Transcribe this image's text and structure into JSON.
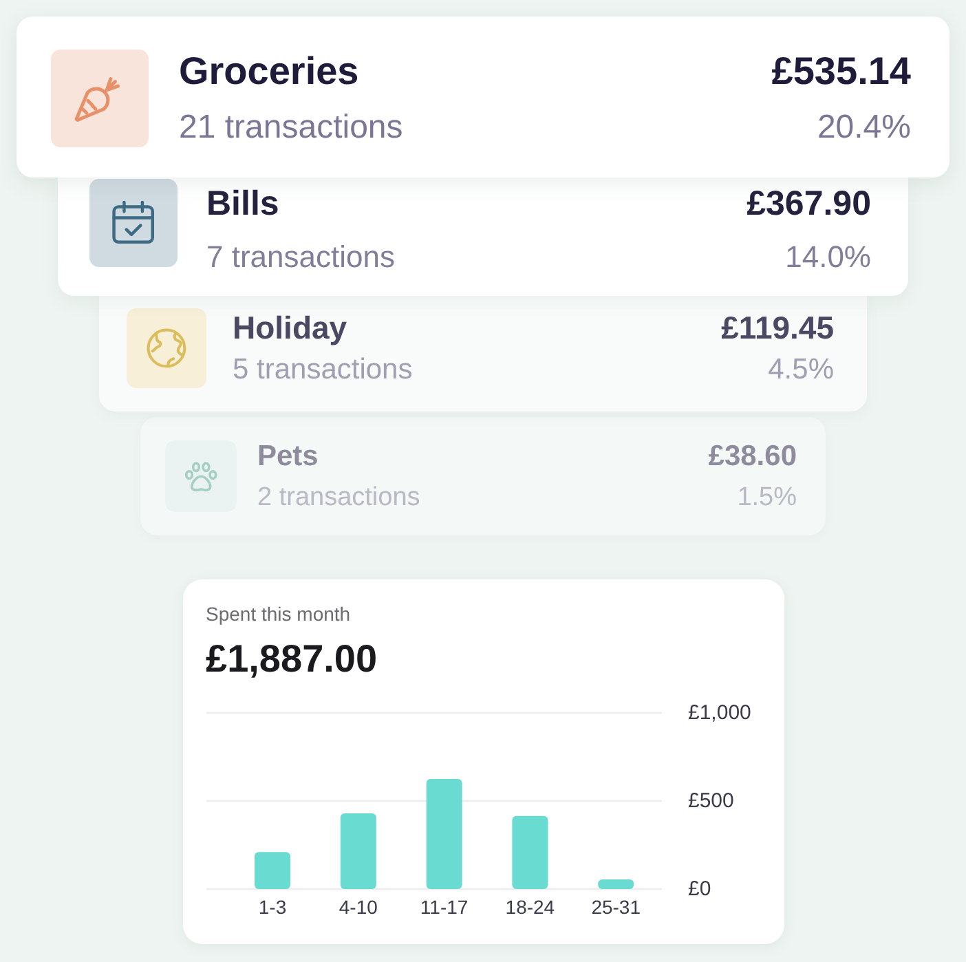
{
  "categories": [
    {
      "name": "Groceries",
      "transactions": "21 transactions",
      "amount": "£535.14",
      "share": "20.4%",
      "color": "#e8906a"
    },
    {
      "name": "Bills",
      "transactions": "7 transactions",
      "amount": "£367.90",
      "share": "14.0%",
      "color": "#3d6b84"
    },
    {
      "name": "Holiday",
      "transactions": "5 transactions",
      "amount": "£119.45",
      "share": "4.5%",
      "color": "#dcbd5c"
    },
    {
      "name": "Pets",
      "transactions": "2 transactions",
      "amount": "£38.60",
      "share": "1.5%",
      "color": "#a6cfc3"
    }
  ],
  "spending": {
    "label": "Spent this month",
    "total": "£1,887.00",
    "chart_data": {
      "type": "bar",
      "categories": [
        "1-3",
        "4-10",
        "11-17",
        "18-24",
        "25-31"
      ],
      "values": [
        210,
        430,
        625,
        415,
        55
      ],
      "ylim": [
        0,
        1000
      ],
      "yticks": [
        {
          "value": 0,
          "label": "£0"
        },
        {
          "value": 500,
          "label": "£500"
        },
        {
          "value": 1000,
          "label": "£1,000"
        }
      ]
    }
  }
}
